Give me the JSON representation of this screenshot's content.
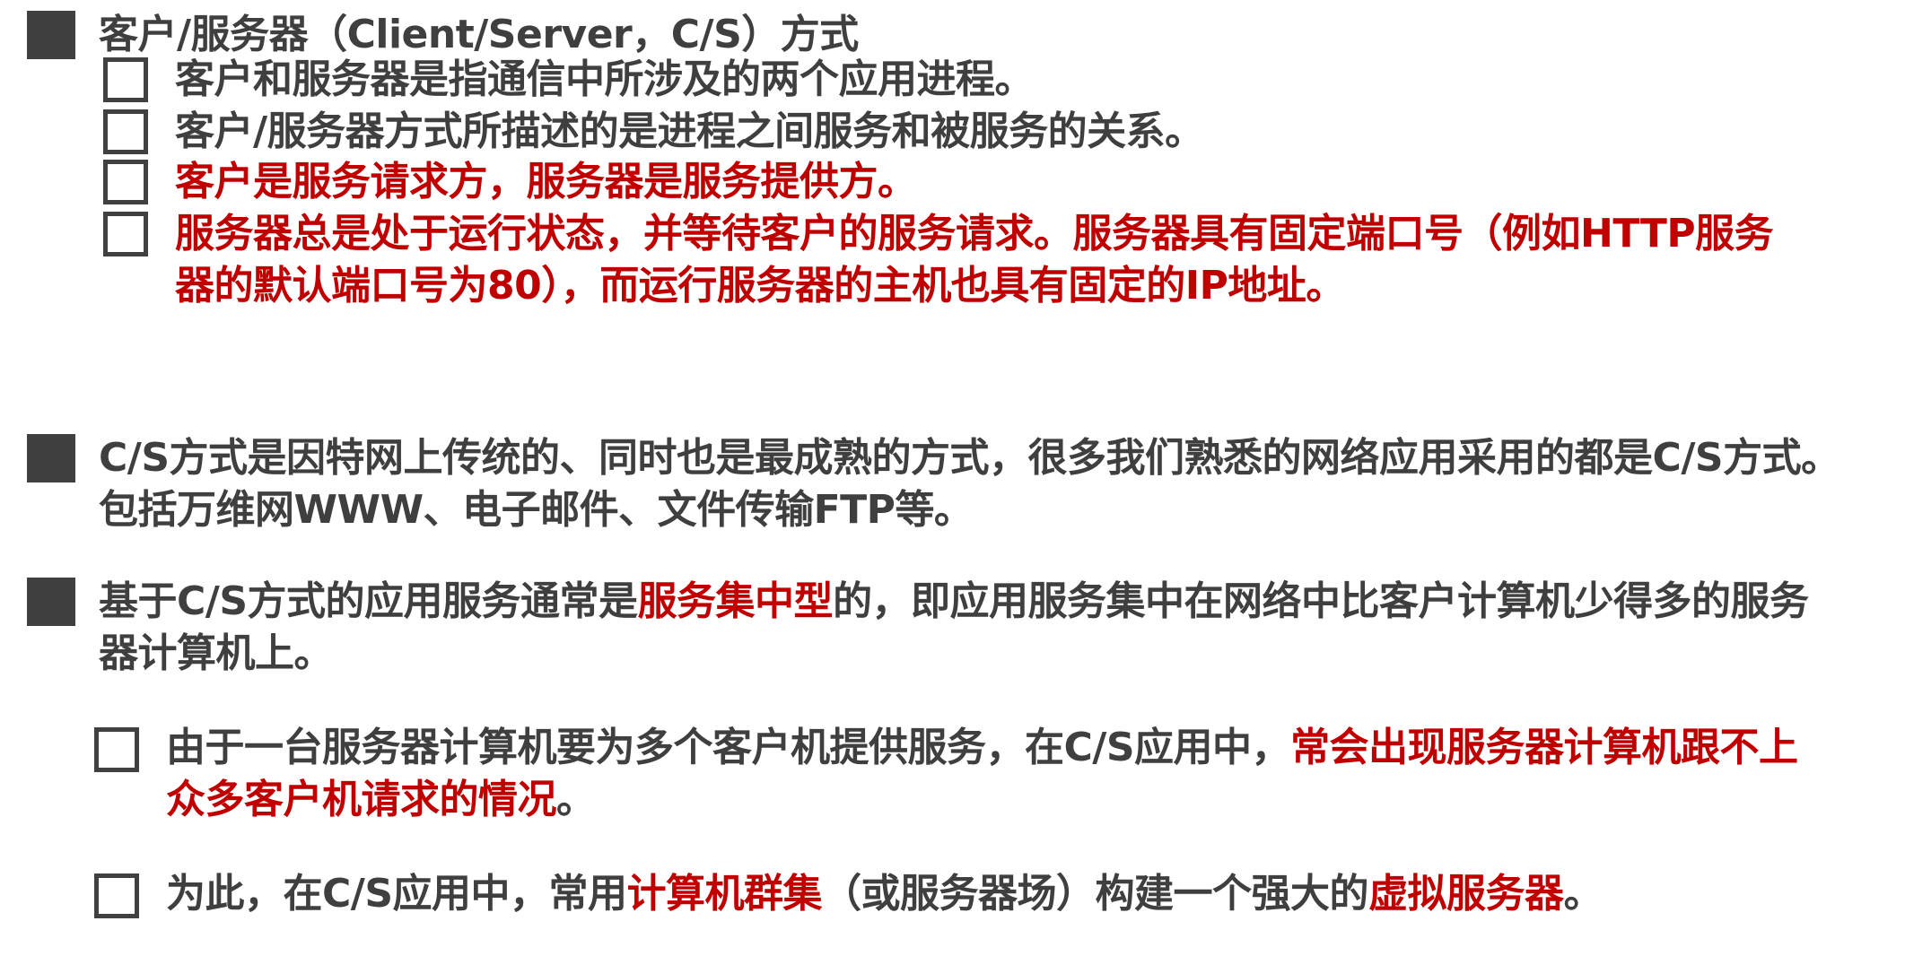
{
  "slide": {
    "p1": {
      "text": "客户/服务器（Client/Server，C/S）方式",
      "sub": [
        {
          "text": "客户和服务器是指通信中所涉及的两个应用进程。"
        },
        {
          "text": "客户/服务器方式所描述的是进程之间服务和被服务的关系。"
        },
        {
          "text": "客户是服务请求方，服务器是服务提供方。"
        },
        {
          "line1": "服务器总是处于运行状态，并等待客户的服务请求。服务器具有固定端口号（例如HTTP服务",
          "line2": "器的默认端口号为80），而运行服务器的主机也具有固定的IP地址。"
        }
      ]
    },
    "p2": {
      "line1": "C/S方式是因特网上传统的、同时也是最成熟的方式，很多我们熟悉的网络应用采用的都是C/S方式。",
      "line2": "包括万维网WWW、电子邮件、文件传输FTP等。"
    },
    "p3": {
      "line1_a": "基于C/S方式的应用服务通常是",
      "line1_b": "服务集中型",
      "line1_c": "的，即应用服务集中在网络中比客户计算机少得多的服务",
      "line2": "器计算机上。",
      "sub": [
        {
          "line1_a": "由于一台服务器计算机要为多个客户机提供服务，在C/S应用中，",
          "line1_b": "常会出现服务器计算机跟不上",
          "line2": "众多客户机请求的情况",
          "line2_end": "。"
        },
        {
          "a": "为此，在C/S应用中，常用",
          "b": "计算机群集",
          "c": "（或服务器场）构建一个强大的",
          "d": "虚拟服务器",
          "e": "。"
        }
      ]
    }
  },
  "colors": {
    "text": "#3f3f3f",
    "emphasis": "#c00000",
    "bullet": "#404040"
  },
  "icons": {
    "level1_bullet": "filled-square-icon",
    "level2_bullet": "hollow-square-icon"
  }
}
